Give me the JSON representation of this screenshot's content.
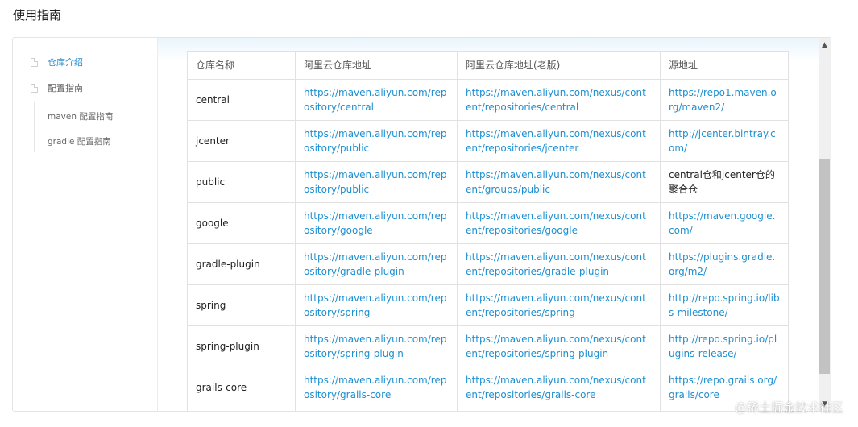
{
  "header": {
    "title": "使用指南"
  },
  "sidebar": {
    "items": [
      {
        "label": "仓库介绍"
      },
      {
        "label": "配置指南"
      },
      {
        "label": "maven 配置指南"
      },
      {
        "label": "gradle 配置指南"
      }
    ]
  },
  "table": {
    "headers": [
      "仓库名称",
      "阿里云仓库地址",
      "阿里云仓库地址(老版)",
      "源地址"
    ],
    "rows": [
      {
        "name": "central",
        "url": "https://maven.aliyun.com/repository/central",
        "old_url": "https://maven.aliyun.com/nexus/content/repositories/central",
        "source": "https://repo1.maven.org/maven2/"
      },
      {
        "name": "jcenter",
        "url": "https://maven.aliyun.com/repository/public",
        "old_url": "https://maven.aliyun.com/nexus/content/repositories/jcenter",
        "source": "http://jcenter.bintray.com/"
      },
      {
        "name": "public",
        "url": "https://maven.aliyun.com/repository/public",
        "old_url": "https://maven.aliyun.com/nexus/content/groups/public",
        "source": "central仓和jcenter仓的聚合仓"
      },
      {
        "name": "google",
        "url": "https://maven.aliyun.com/repository/google",
        "old_url": "https://maven.aliyun.com/nexus/content/repositories/google",
        "source": "https://maven.google.com/"
      },
      {
        "name": "gradle-plugin",
        "url": "https://maven.aliyun.com/repository/gradle-plugin",
        "old_url": "https://maven.aliyun.com/nexus/content/repositories/gradle-plugin",
        "source": "https://plugins.gradle.org/m2/"
      },
      {
        "name": "spring",
        "url": "https://maven.aliyun.com/repository/spring",
        "old_url": "https://maven.aliyun.com/nexus/content/repositories/spring",
        "source": "http://repo.spring.io/libs-milestone/"
      },
      {
        "name": "spring-plugin",
        "url": "https://maven.aliyun.com/repository/spring-plugin",
        "old_url": "https://maven.aliyun.com/nexus/content/repositories/spring-plugin",
        "source": "http://repo.spring.io/plugins-release/"
      },
      {
        "name": "grails-core",
        "url": "https://maven.aliyun.com/repository/grails-core",
        "old_url": "https://maven.aliyun.com/nexus/content/repositories/grails-core",
        "source": "https://repo.grails.org/grails/core"
      }
    ]
  },
  "watermark": "@稀土掘金技术社区",
  "icons": {
    "sidebar": "document-icon",
    "scroll_up": "chevron-up-icon",
    "scroll_down": "chevron-down-icon"
  },
  "colors": {
    "link": "#1e8fd0",
    "active": "#2a91d0",
    "border": "#e1e1e1"
  }
}
